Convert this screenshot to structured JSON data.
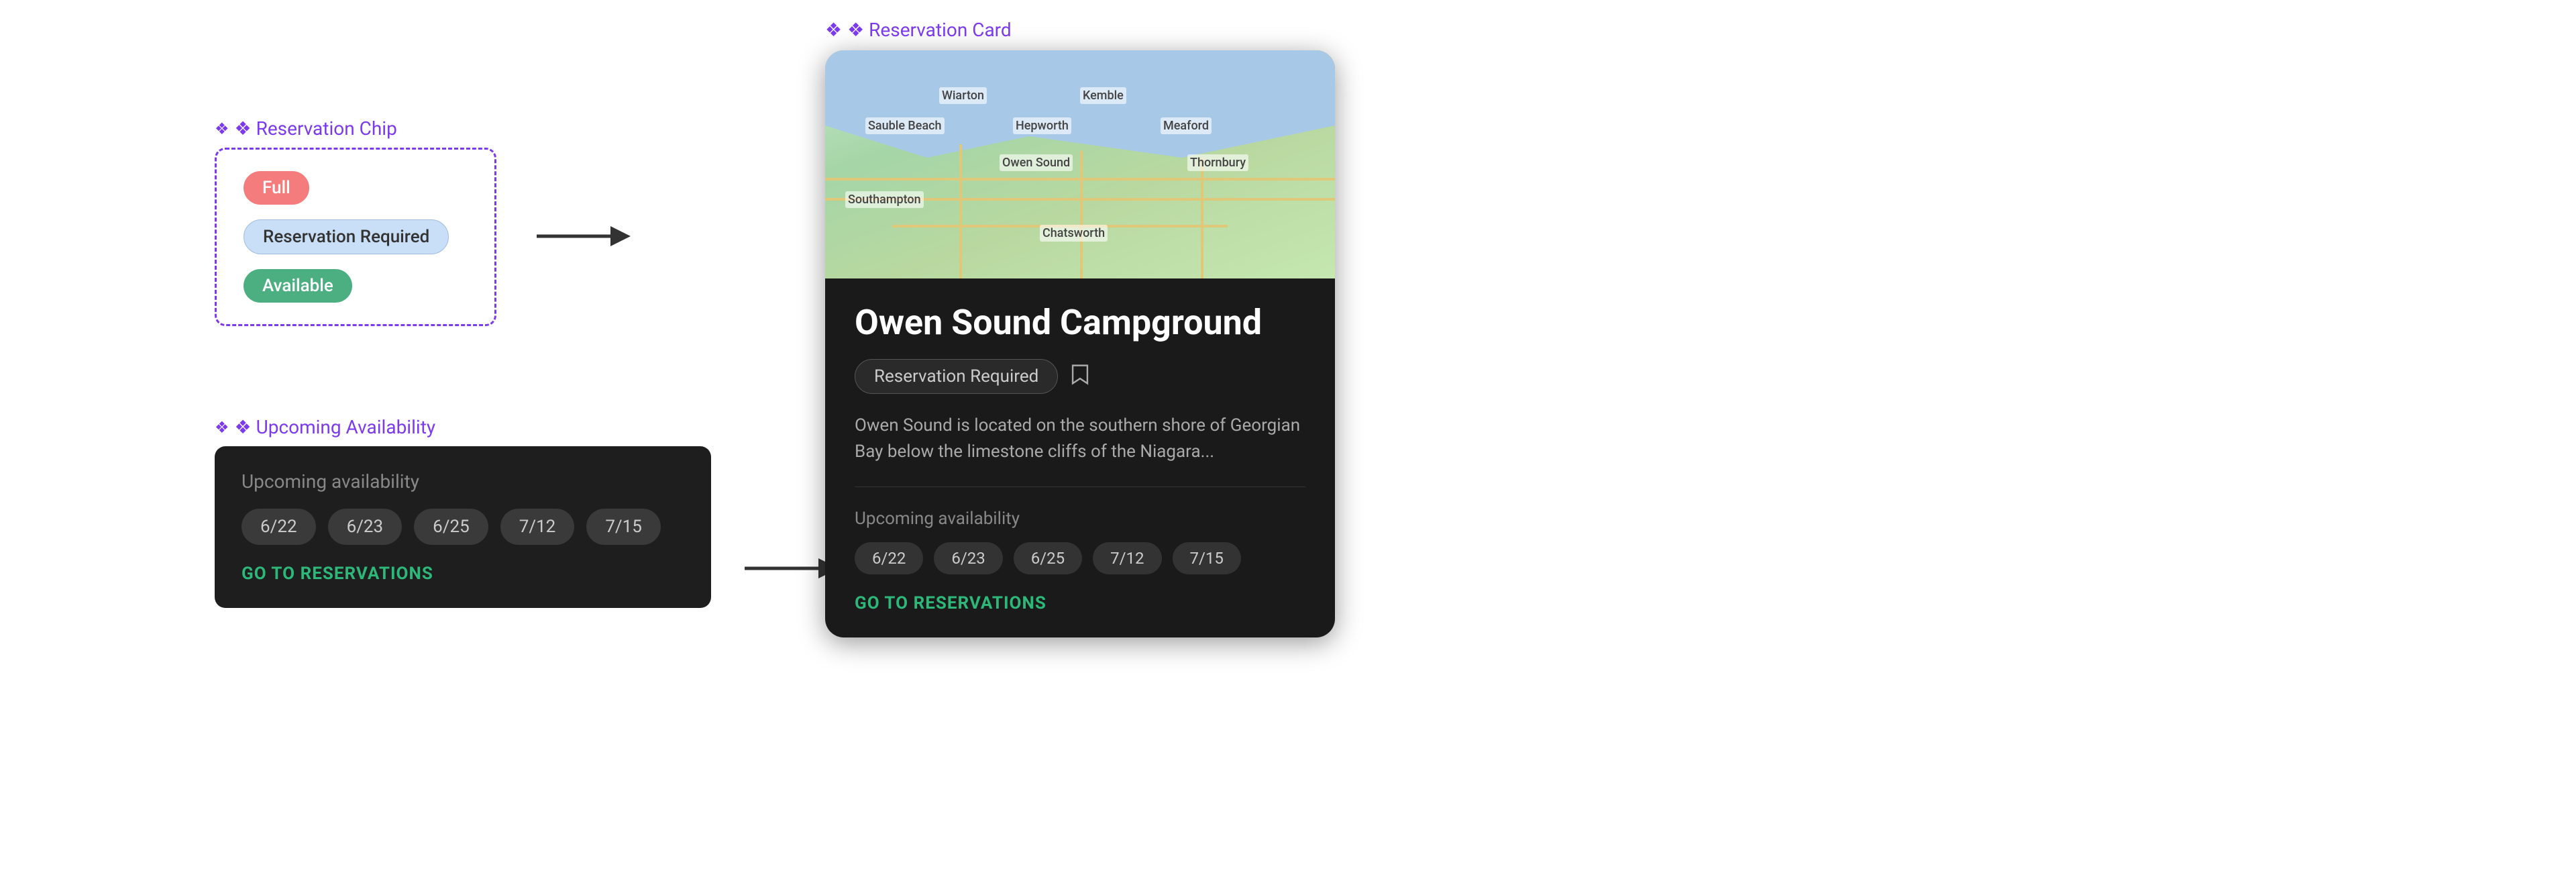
{
  "reservationChip": {
    "label": "❖ Reservation Chip",
    "chips": {
      "full": "Full",
      "reservationRequired": "Reservation Required",
      "available": "Available"
    }
  },
  "upcomingAvailability": {
    "label": "❖ Upcoming Availability",
    "sectionLabel": "Upcoming availability",
    "dates": [
      "6/22",
      "6/23",
      "6/25",
      "7/12",
      "7/15"
    ],
    "goToReservations": "GO TO RESERVATIONS"
  },
  "reservationCard": {
    "label": "❖ Reservation Card",
    "title": "Owen Sound Campground",
    "chipLabel": "Reservation Required",
    "description": "Owen Sound is located on the southern shore of Georgian Bay below the limestone cliffs of the Niagara...",
    "upcomingLabel": "Upcoming availability",
    "dates": [
      "6/22",
      "6/23",
      "6/25",
      "7/12",
      "7/15"
    ],
    "goToReservations": "GO TO RESERVATIONS"
  },
  "arrows": {
    "arrow1": "→",
    "arrow2": "→"
  }
}
